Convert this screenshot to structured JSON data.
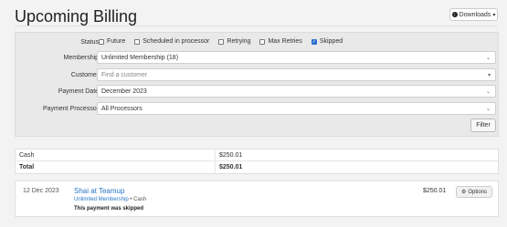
{
  "header": {
    "title": "Upcoming Billing",
    "downloads_label": "Downloads"
  },
  "filters": {
    "status_label": "Status:",
    "status_options": [
      {
        "label": "Future",
        "checked": false
      },
      {
        "label": "Scheduled in processor",
        "checked": false
      },
      {
        "label": "Retrying",
        "checked": false
      },
      {
        "label": "Max Retries",
        "checked": false
      },
      {
        "label": "Skipped",
        "checked": true
      }
    ],
    "membership_label": "Membership:",
    "membership_value": "Unlimited Membership (18)",
    "customer_label": "Customer:",
    "customer_placeholder": "Find a customer",
    "payment_date_label": "Payment Date:",
    "payment_date_value": "December 2023",
    "payment_processor_label": "Payment Processor:",
    "payment_processor_value": "All Processors",
    "filter_button": "Filter"
  },
  "totals": {
    "rows": [
      {
        "label": "Cash",
        "value": "$250.01",
        "bold": false
      },
      {
        "label": "Total",
        "value": "$250.01",
        "bold": true
      }
    ]
  },
  "payments": [
    {
      "date": "12 Dec 2023",
      "customer": "Shai at Teamup",
      "membership": "Unlimited Membership",
      "separator": "•",
      "method": "Cash",
      "note": "This payment was skipped",
      "amount": "$250.01",
      "options_label": "Options"
    }
  ]
}
